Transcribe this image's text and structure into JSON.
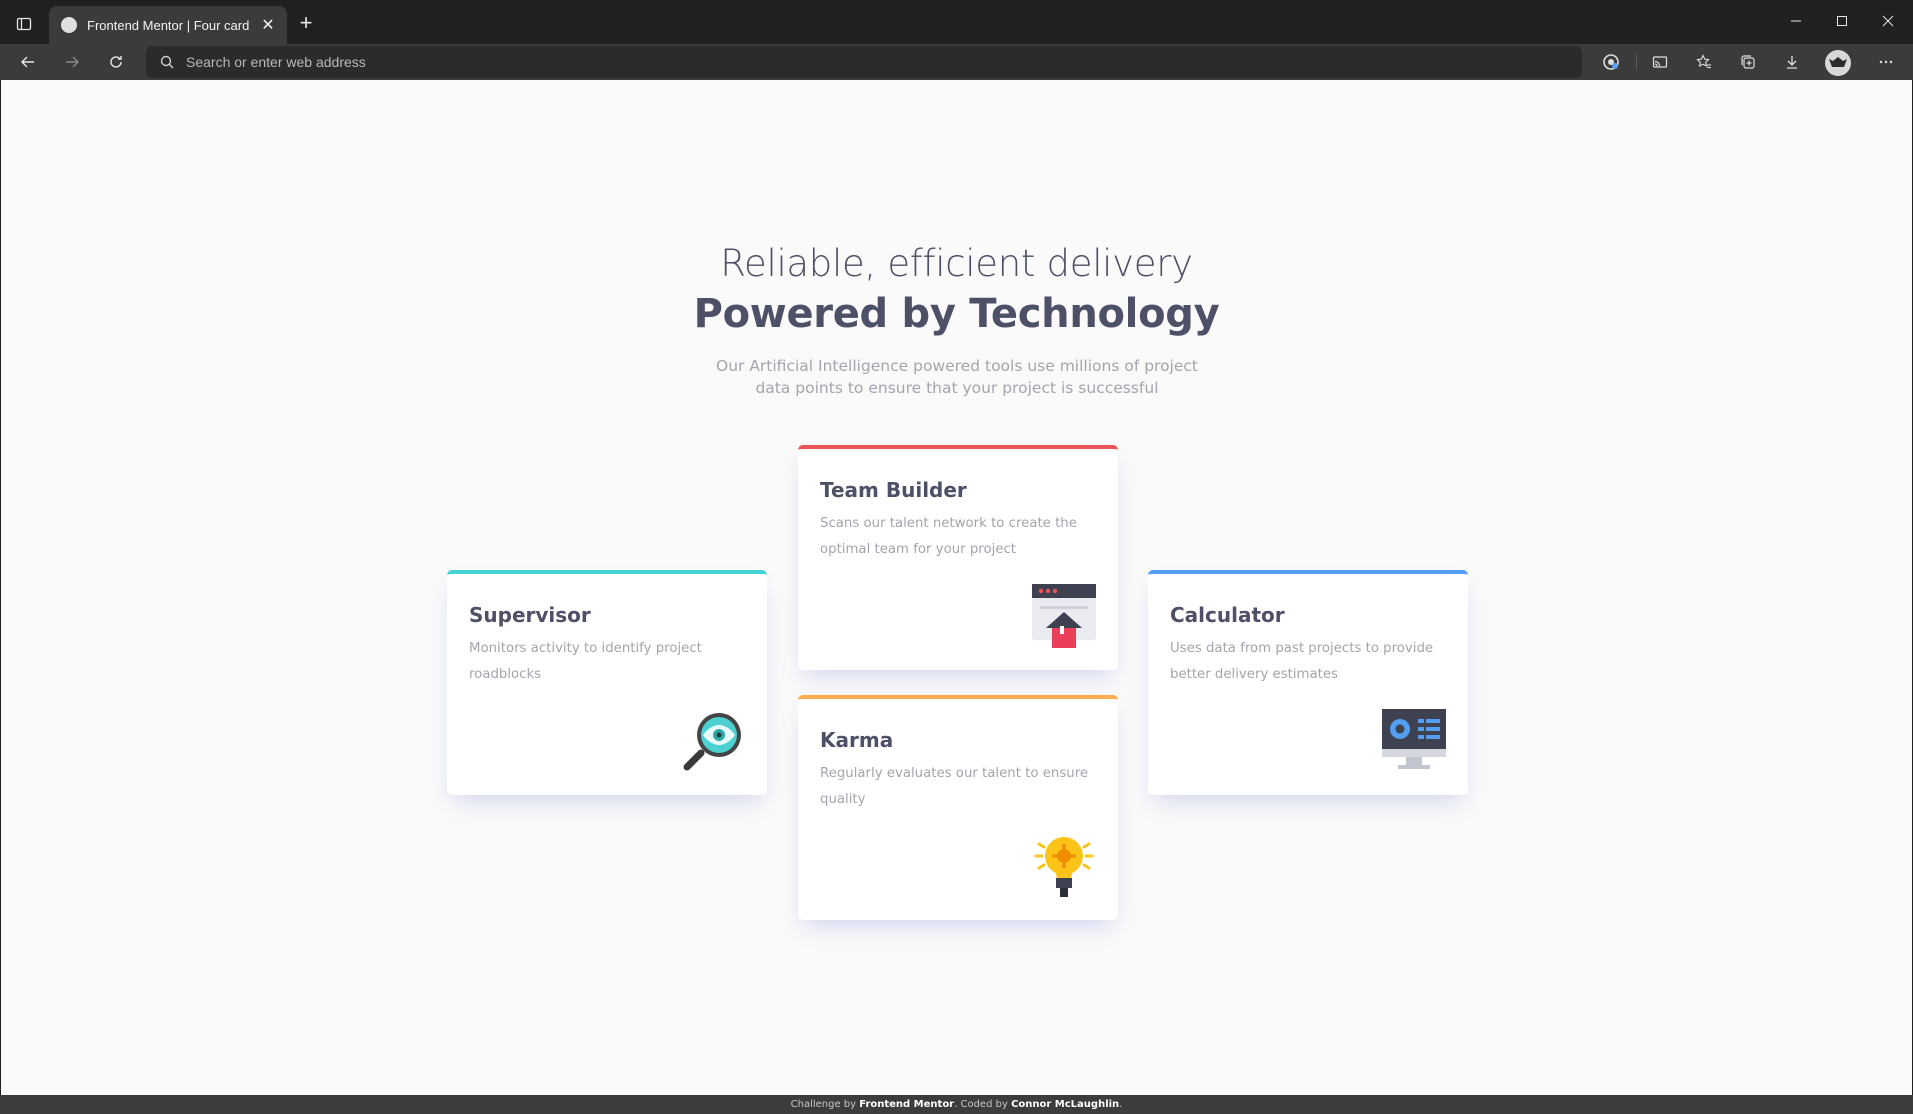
{
  "browser": {
    "tab_title": "Frontend Mentor | Four card feature section",
    "address_placeholder": "Search or enter web address"
  },
  "page": {
    "heading_light": "Reliable, efficient delivery",
    "heading_bold": "Powered by Technology",
    "intro": "Our Artificial Intelligence powered tools use millions of project data points to ensure that your project is successful",
    "cards": [
      {
        "title": "Supervisor",
        "description": "Monitors activity to identify project roadblocks",
        "accent": "#44d3d2",
        "icon": "supervisor-magnifier-icon"
      },
      {
        "title": "Team Builder",
        "description": "Scans our talent network to create the optimal team for your project",
        "accent": "#ea5454",
        "icon": "team-builder-icon"
      },
      {
        "title": "Karma",
        "description": "Regularly evaluates our talent to ensure quality",
        "accent": "#fcae4a",
        "icon": "karma-lightbulb-icon"
      },
      {
        "title": "Calculator",
        "description": "Uses data from past projects to provide better delivery estimates",
        "accent": "#549ef2",
        "icon": "calculator-monitor-icon"
      }
    ],
    "footer": {
      "prefix": "Challenge by ",
      "challenge_link": "Frontend Mentor",
      "middle": ". Coded by ",
      "author_link": "Connor McLaughlin",
      "suffix": "."
    }
  },
  "colors": {
    "page_background": "#fafafa",
    "heading_text": "#4d5066",
    "body_text": "#a3a5ae"
  }
}
